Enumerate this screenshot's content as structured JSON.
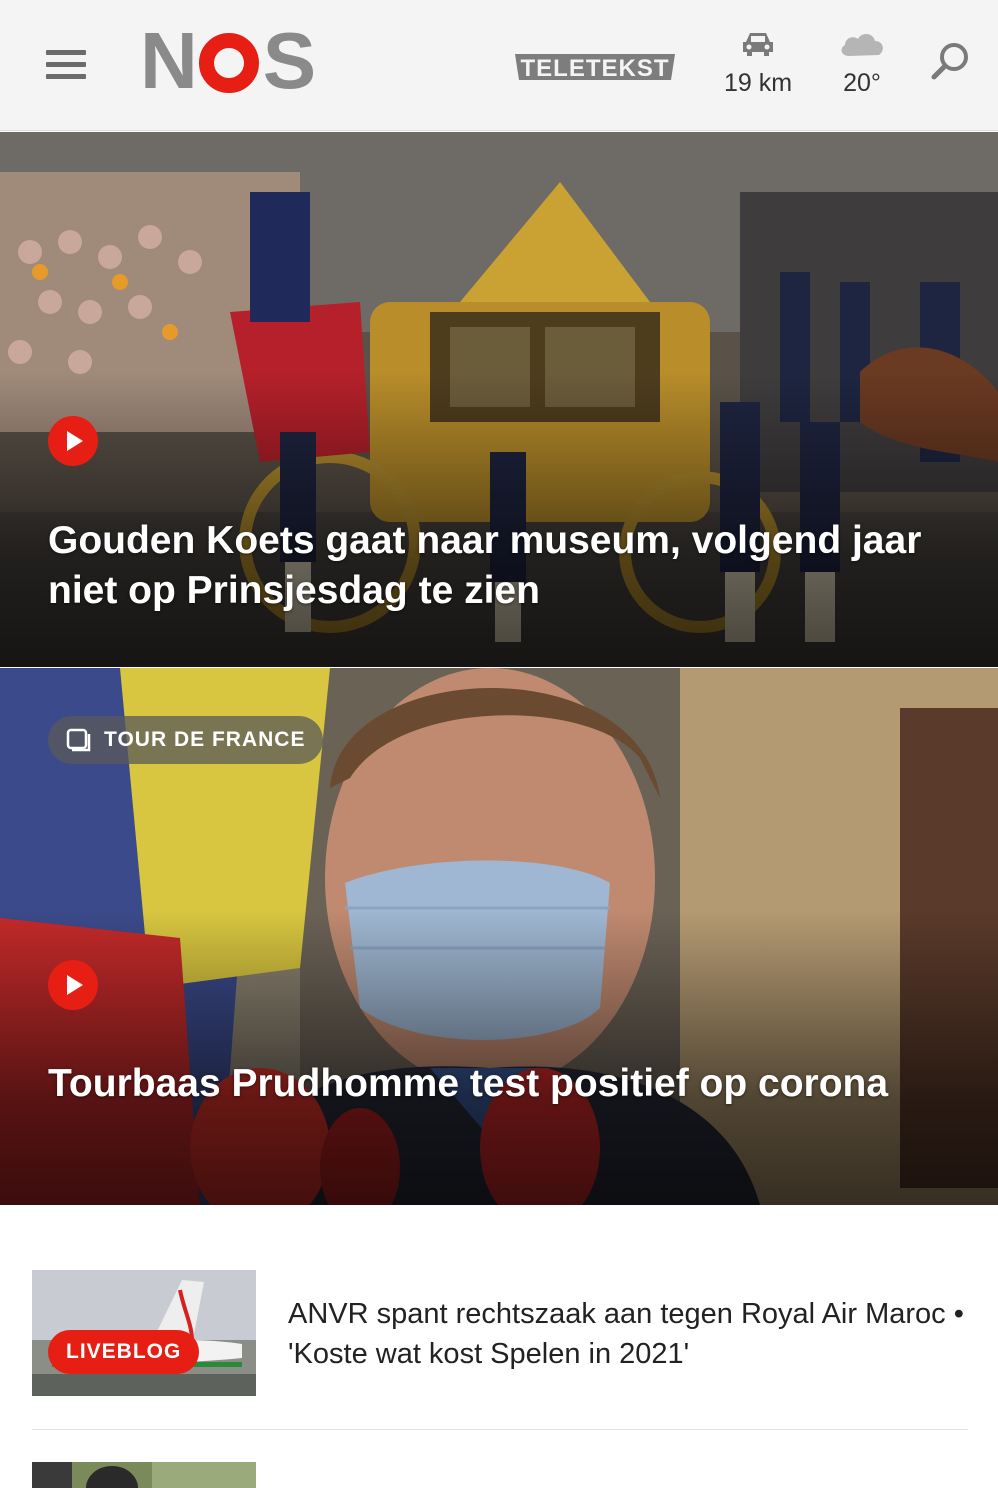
{
  "header": {
    "logo_text": "NOS",
    "teletekst_label": "TELETEKST",
    "traffic": {
      "icon": "car-icon",
      "value": "19 km"
    },
    "weather": {
      "icon": "cloud-icon",
      "value": "20°"
    },
    "search_icon": "search-icon",
    "menu_icon": "hamburger-menu-icon"
  },
  "hero": [
    {
      "headline": "Gouden Koets gaat naar museum, volgend jaar niet op Prinsjesdag te zien",
      "media": "video"
    },
    {
      "tag": "TOUR DE FRANCE",
      "headline": "Tourbaas Prudhomme test positief op corona",
      "media": "video"
    }
  ],
  "list": [
    {
      "badge": "LIVEBLOG",
      "title": "ANVR spant rechtszaak aan tegen Royal Air Maroc • 'Koste wat kost Spelen in 2021'"
    }
  ],
  "colors": {
    "accent": "#e61e14",
    "header_bg": "#f4f4f4",
    "logo_grey": "#8a8a8a"
  }
}
